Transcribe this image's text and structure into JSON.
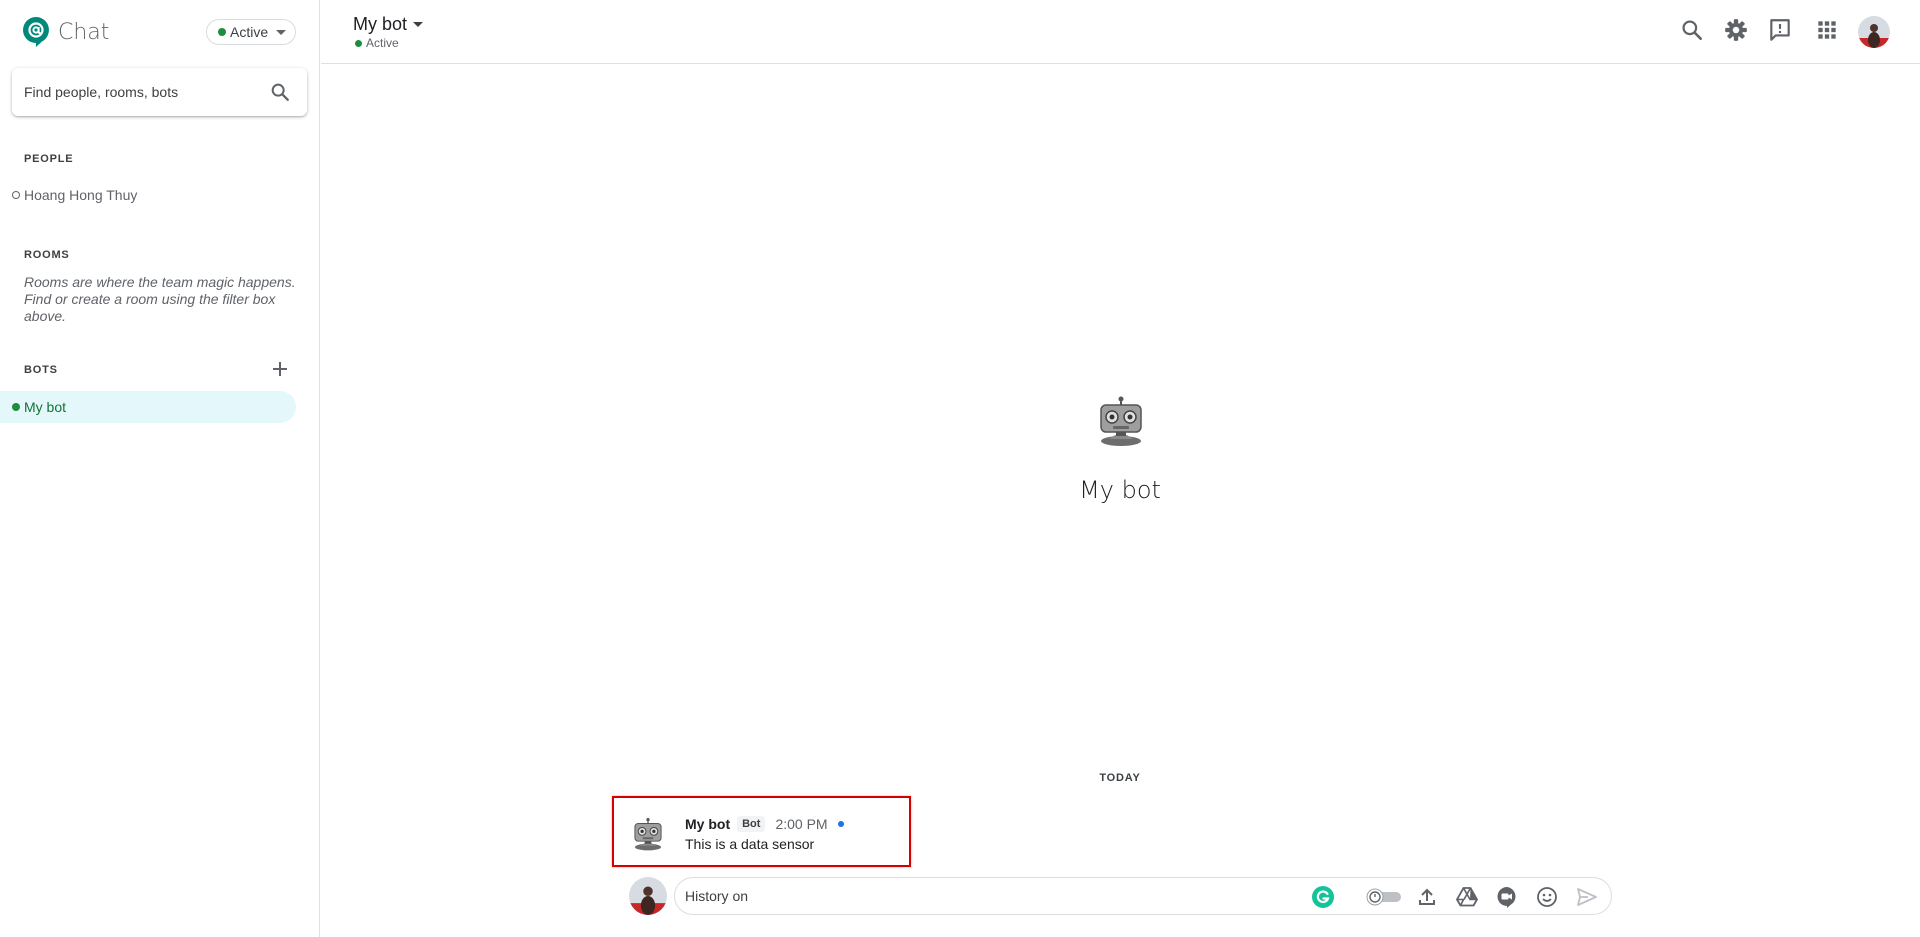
{
  "app": {
    "name": "Chat"
  },
  "status": {
    "label": "Active",
    "color": "#1e8e3e"
  },
  "search": {
    "placeholder": "Find people, rooms, bots"
  },
  "sections": {
    "people": {
      "title": "PEOPLE",
      "items": [
        {
          "label": "Hoang Hong Thuy",
          "status": "offline"
        }
      ]
    },
    "rooms": {
      "title": "ROOMS",
      "note": "Rooms are where the team magic happens. Find or create a room using the filter box above."
    },
    "bots": {
      "title": "BOTS",
      "items": [
        {
          "label": "My bot",
          "status": "active",
          "selected": true
        }
      ]
    }
  },
  "header": {
    "title": "My bot",
    "status": "Active",
    "icons": [
      "search-icon",
      "gear-icon",
      "feedback-icon",
      "apps-grid-icon",
      "account-avatar"
    ]
  },
  "intro": {
    "name": "My bot"
  },
  "conversation": {
    "date_label": "TODAY",
    "messages": [
      {
        "sender": "My bot",
        "badge": "Bot",
        "time": "2:00 PM",
        "text": "This is a data sensor"
      }
    ]
  },
  "composer": {
    "placeholder": "History on",
    "icons": [
      "grammarly-icon",
      "history-toggle",
      "upload-icon",
      "drive-icon",
      "meet-icon",
      "emoji-icon",
      "send-icon"
    ]
  },
  "colors": {
    "selected_bg": "#e4f7fb",
    "active_green": "#1e8e3e",
    "highlight_border": "#d50000",
    "brand_teal": "#00897b"
  }
}
